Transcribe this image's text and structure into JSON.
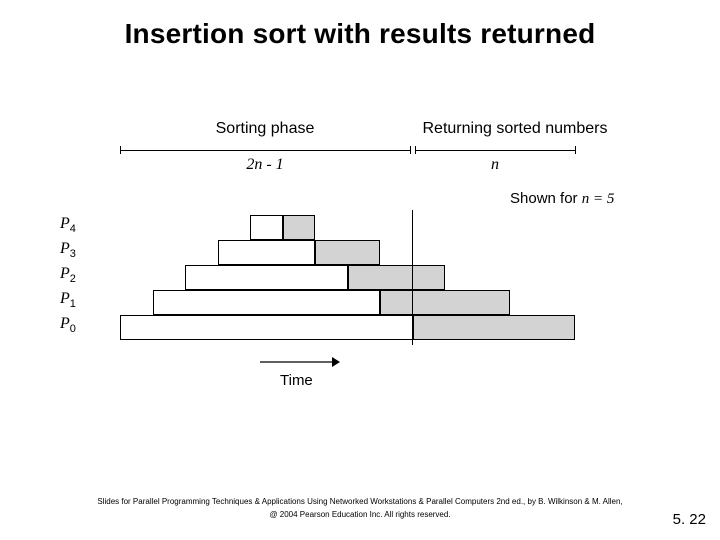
{
  "title": "Insertion sort with results returned",
  "labels": {
    "sorting_phase": "Sorting phase",
    "returning": "Returning sorted numbers",
    "formula_left": "2n - 1",
    "formula_right": "n",
    "shown_prefix": "Shown for ",
    "shown_eq_text": "n = 5",
    "time": "Time"
  },
  "processes": [
    {
      "name": "P",
      "sub": "4"
    },
    {
      "name": "P",
      "sub": "3"
    },
    {
      "name": "P",
      "sub": "2"
    },
    {
      "name": "P",
      "sub": "1"
    },
    {
      "name": "P",
      "sub": "0"
    }
  ],
  "chart_data": {
    "type": "gantt-diagram",
    "n": 5,
    "time_axis_length": 14,
    "sorting_phase_span": [
      0,
      9
    ],
    "returning_phase_span": [
      9,
      14
    ],
    "rows": [
      {
        "process": "P4",
        "sort_span": [
          4,
          5
        ],
        "ret_span": [
          5,
          6
        ]
      },
      {
        "process": "P3",
        "sort_span": [
          3,
          6
        ],
        "ret_span": [
          6,
          8
        ]
      },
      {
        "process": "P2",
        "sort_span": [
          2,
          7
        ],
        "ret_span": [
          7,
          10
        ]
      },
      {
        "process": "P1",
        "sort_span": [
          1,
          8
        ],
        "ret_span": [
          8,
          12
        ]
      },
      {
        "process": "P0",
        "sort_span": [
          0,
          9
        ],
        "ret_span": [
          9,
          14
        ]
      }
    ]
  },
  "footer": {
    "line1": "Slides for Parallel Programming Techniques & Applications Using Networked Workstations & Parallel Computers 2nd ed., by B. Wilkinson & M. Allen,",
    "line2": "@ 2004 Pearson Education Inc. All rights reserved."
  },
  "page_number": "5. 22"
}
